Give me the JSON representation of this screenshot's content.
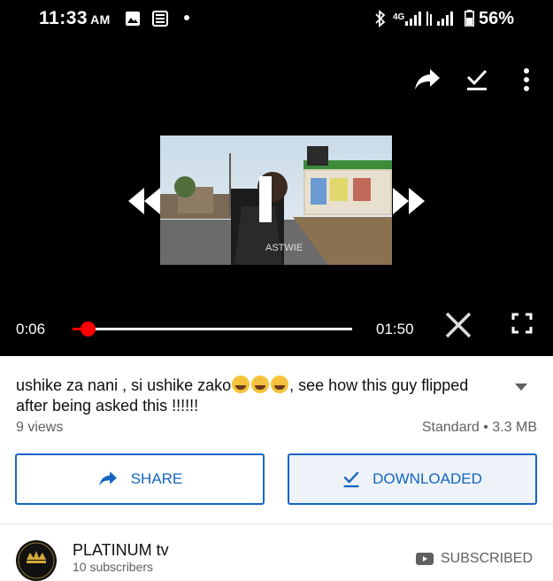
{
  "status_bar": {
    "time": "11:33",
    "ampm": "AM",
    "network": "4G",
    "battery": "56%"
  },
  "player": {
    "current_time": "0:06",
    "duration": "01:50",
    "progress_fraction": 0.05,
    "frame_text": "ASTWIE",
    "icons": [
      "share-icon",
      "check-icon",
      "more-icon",
      "rewind-icon",
      "fast-forward-icon",
      "close-icon",
      "fullscreen-icon"
    ],
    "accent_color": "#ff0000"
  },
  "video": {
    "title_part1": "ushike za nani , si ushike zako",
    "title_part2": ", see how this guy flipped after being asked this !!!!!!",
    "views": "9 views",
    "quality": "Standard • 3.3 MB"
  },
  "actions": {
    "share_label": "SHARE",
    "download_label": "DOWNLOADED",
    "color": "#1565c0"
  },
  "channel": {
    "name": "PLATINUM tv",
    "subscribers": "10 subscribers",
    "subscribed_label": "SUBSCRIBED"
  }
}
